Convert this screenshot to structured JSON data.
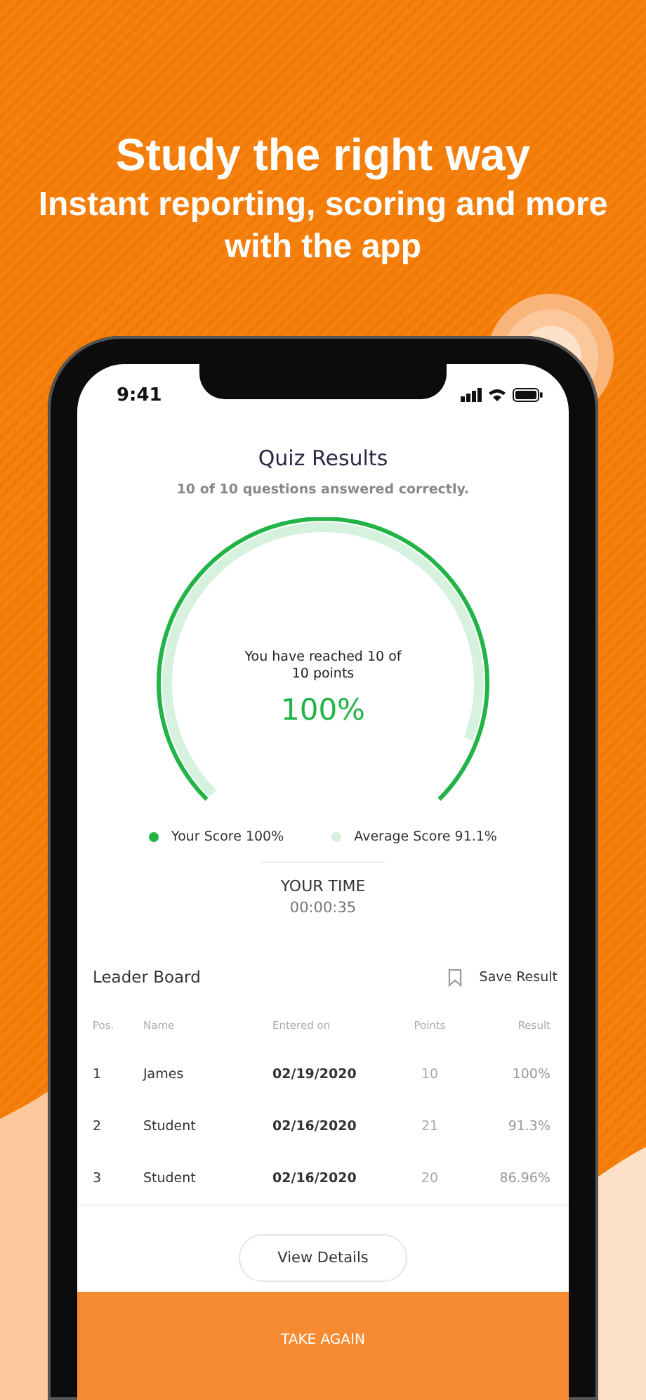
{
  "headline": {
    "title": "Study the right way",
    "subtitle": "Instant reporting, scoring and more with the app"
  },
  "status_bar": {
    "time": "9:41"
  },
  "quiz": {
    "title": "Quiz Results",
    "summary": "10 of 10 questions answered correctly.",
    "gauge": {
      "caption": "You have reached 10 of 10 points",
      "percent": "100%"
    },
    "legend": [
      {
        "label": "Your Score 100%",
        "color": "#22b447",
        "level": 1
      },
      {
        "label": "Average Score 91.1%",
        "color": "#d6f1de",
        "level": 0.911
      }
    ],
    "time": {
      "label": "YOUR TIME",
      "value": "00:00:35"
    }
  },
  "leader_board": {
    "title": "Leader Board",
    "save_action": "Save Result",
    "columns": [
      "Pos.",
      "Name",
      "Entered on",
      "Points",
      "Result"
    ],
    "rows": [
      [
        "1",
        "James",
        "02/19/2020",
        "10",
        "100%"
      ],
      [
        "2",
        "Student",
        "02/16/2020",
        "21",
        "91.3%"
      ],
      [
        "3",
        "Student",
        "02/16/2020",
        "20",
        "86.96%"
      ]
    ]
  },
  "buttons": {
    "details": "View Details",
    "retake": "TAKE AGAIN"
  }
}
